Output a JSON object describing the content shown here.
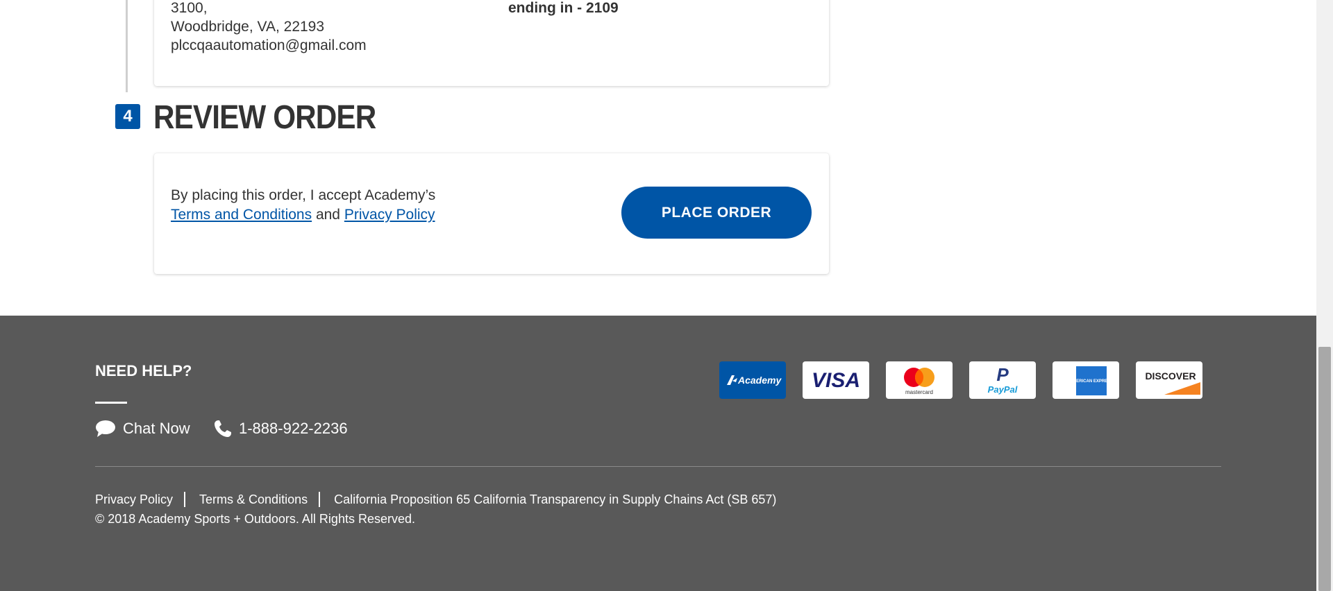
{
  "shipping": {
    "address_line": "3100,",
    "city_state_zip": "Woodbridge, VA, 22193",
    "email": "plccqaautomation@gmail.com"
  },
  "payment": {
    "ending": "ending in - 2109"
  },
  "review": {
    "step_number": "4",
    "title": "REVIEW ORDER",
    "accept_text": "By placing this order, I accept Academy’s",
    "terms_link": "Terms and Conditions",
    "and_text": "and",
    "privacy_link": "Privacy Policy",
    "place_order_label": "PLACE ORDER"
  },
  "footer": {
    "need_help": "NEED HELP?",
    "chat_label": "Chat Now",
    "phone": "1-888-922-2236",
    "payment_cards": [
      {
        "name": "Academy",
        "icon": "academy-card-icon"
      },
      {
        "name": "VISA",
        "icon": "visa-icon"
      },
      {
        "name": "mastercard",
        "icon": "mastercard-icon"
      },
      {
        "name": "PayPal",
        "icon": "paypal-icon"
      },
      {
        "name": "AMERICAN EXPRESS",
        "icon": "amex-icon"
      },
      {
        "name": "DISCOVER",
        "icon": "discover-icon"
      }
    ],
    "links": {
      "privacy": "Privacy Policy",
      "terms": "Terms & Conditions",
      "california": "California Proposition 65 California Transparency in Supply Chains Act (SB 657)"
    },
    "copyright": "© 2018 Academy Sports + Outdoors. All Rights Reserved."
  },
  "colors": {
    "brand_blue": "#0055a6",
    "footer_bg": "#595959",
    "text_dark": "#333333"
  }
}
